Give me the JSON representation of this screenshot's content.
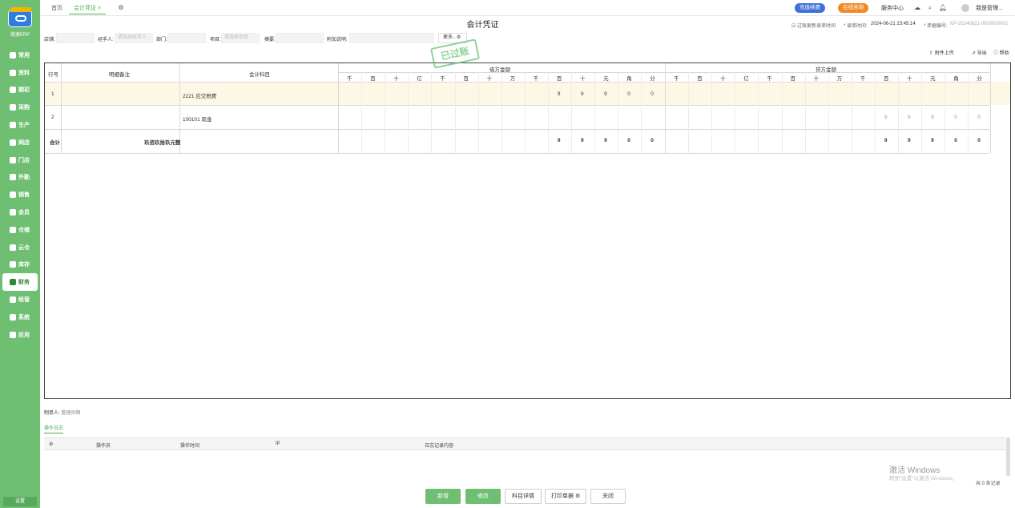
{
  "sidebar": {
    "logo_badge": "让生意更",
    "logo_caption": "揽捷ERP",
    "items": [
      "常用",
      "资料",
      "期初",
      "采购",
      "生产",
      "网店",
      "门店",
      "外勤",
      "销售",
      "会员",
      "仓储",
      "云仓",
      "库存",
      "财务",
      "经营",
      "系统",
      "应用"
    ],
    "active_index": 13,
    "settings_label": "设置"
  },
  "topbar": {
    "tabs": [
      "首页",
      "会计凭证 ×"
    ],
    "pill_vip": "充值续费",
    "pill_chat": "在线咨询",
    "service": "服务中心",
    "user": "我是管理..."
  },
  "header": {
    "title": "会计凭证",
    "checkbox_label": "过账更新录单时间",
    "date_label": "* 录单时间:",
    "date_value": "2024-06-21 23:45:14",
    "no_label": "* 单据编号:",
    "no_value": "KP-20240621-0000000002"
  },
  "filters": {
    "store_label": "店铺:",
    "handler_label": "经手人:",
    "handler_placeholder": "请选择经手人",
    "dept_label": "部门:",
    "project_label": "项目:",
    "project_placeholder": "请选择项目",
    "summary_label": "摘要:",
    "extra_label": "附加说明:",
    "more_label": "更多.."
  },
  "tools": {
    "upload": "附件上传",
    "export": "导出",
    "help": "帮助"
  },
  "stamp": "已过账",
  "table": {
    "col_row": "行号",
    "col_note": "明细备注",
    "col_subject": "会计科目",
    "col_debit": "借方金额",
    "col_credit": "贷方金额",
    "digits": [
      "千",
      "百",
      "十",
      "亿",
      "千",
      "百",
      "十",
      "万",
      "千",
      "百",
      "十",
      "元",
      "角",
      "分"
    ],
    "rows": [
      {
        "no": "1",
        "note": "",
        "subject": "2221 应交税费",
        "debit": [
          "",
          "",
          "",
          "",
          "",
          "",
          "",
          "",
          "",
          "9",
          "9",
          "9",
          "0",
          "0"
        ],
        "credit": [
          "",
          "",
          "",
          "",
          "",
          "",
          "",
          "",
          "",
          "",
          "",
          "",
          "",
          ""
        ]
      },
      {
        "no": "2",
        "note": "",
        "subject": "100101 现金",
        "debit": [
          "",
          "",
          "",
          "",
          "",
          "",
          "",
          "",
          "",
          "",
          "",
          "",
          "",
          ""
        ],
        "credit": [
          "",
          "",
          "",
          "",
          "",
          "",
          "",
          "",
          "",
          "9",
          "9",
          "9",
          "0",
          "0"
        ]
      }
    ],
    "total": {
      "label": "合计",
      "words": "玖佰玖拾玖元整",
      "debit": [
        "",
        "",
        "",
        "",
        "",
        "",
        "",
        "",
        "",
        "9",
        "9",
        "9",
        "0",
        "0"
      ],
      "credit": [
        "",
        "",
        "",
        "",
        "",
        "",
        "",
        "",
        "",
        "9",
        "9",
        "9",
        "0",
        "0"
      ]
    }
  },
  "footer": {
    "maker_label": "制单人:",
    "maker_value": "管理员啊",
    "log_tab": "操作日志",
    "log_cols": [
      "操作员",
      "操作时间",
      "IP",
      "日志记录内容"
    ],
    "count": "共 0 条记录",
    "watermark": "激活 Windows",
    "watermark_sub": "转到\"设置\"以激活 Windows。"
  },
  "buttons": {
    "add": "新增",
    "edit": "修改",
    "detail": "科目详情",
    "print": "打印单据",
    "close": "关闭"
  },
  "colors": {
    "accent": "#6fbf73",
    "row_highlight": "#fdf8e6"
  }
}
